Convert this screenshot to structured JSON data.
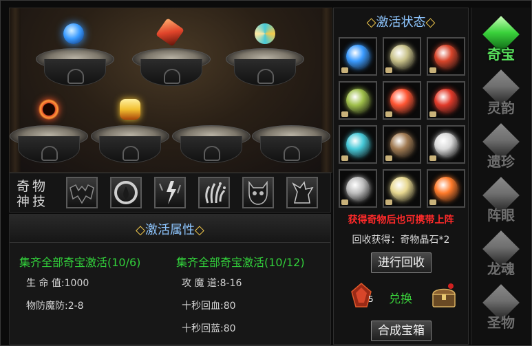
{
  "scene": {
    "altars": [
      {
        "item": "blue-orb-item",
        "color": "#3a9bff",
        "placed": true
      },
      {
        "item": "red-crossbow-item",
        "color": "#e0442a",
        "placed": true
      },
      {
        "item": "jade-swirl-item",
        "color": "#46c9d8",
        "placed": true
      },
      {
        "item": "fire-ring-item",
        "color": "#e8532a",
        "placed": true
      },
      {
        "item": "golden-lantern-item",
        "color": "#f2c030",
        "placed": true
      },
      {
        "item": "empty-altar",
        "color": "",
        "placed": false
      },
      {
        "item": "empty-altar",
        "color": "",
        "placed": false
      }
    ]
  },
  "skills": {
    "title": "奇物神技",
    "icons": [
      "demon-mask-icon",
      "flame-circle-icon",
      "lightning-strike-icon",
      "claw-hand-icon",
      "horned-skull-icon",
      "dark-beast-icon"
    ]
  },
  "attributes": {
    "title": "激活属性",
    "col1": {
      "header": "集齐全部奇宝激活(10/6)",
      "stats": [
        {
          "label": "生  命  值:",
          "value": "1000"
        },
        {
          "label": "物防魔防:",
          "value": "2-8"
        }
      ]
    },
    "col2": {
      "header": "集齐全部奇宝激活(10/12)",
      "stats": [
        {
          "label": "攻  魔  道:",
          "value": "8-16"
        },
        {
          "label": "十秒回血:",
          "value": "80"
        },
        {
          "label": "十秒回蓝:",
          "value": "80"
        }
      ]
    }
  },
  "status": {
    "title": "激活状态",
    "slots": [
      {
        "icon": "blue-orb-icon",
        "color": "#3a9bff"
      },
      {
        "icon": "scroll-icon",
        "color": "#c9c28a"
      },
      {
        "icon": "crossbow-icon",
        "color": "#d8442a"
      },
      {
        "icon": "jade-cube-icon",
        "color": "#9fbf4a"
      },
      {
        "icon": "red-pearl-icon",
        "color": "#ff5533"
      },
      {
        "icon": "fire-ring-icon",
        "color": "#e23a2a"
      },
      {
        "icon": "jade-swirl-icon",
        "color": "#46c9d8"
      },
      {
        "icon": "bead-bracelet-icon",
        "color": "#a07a52"
      },
      {
        "icon": "silver-orb-icon",
        "color": "#d8d8d8"
      },
      {
        "icon": "silver-bell-icon",
        "color": "#bdbdbd"
      },
      {
        "icon": "golden-talisman-icon",
        "color": "#e8d890"
      },
      {
        "icon": "rainbow-disc-icon",
        "color": "#ff7a2a"
      }
    ],
    "warning": "获得奇物后也可携带上阵",
    "recycle_text": "回收获得：奇物晶石*2",
    "recycle_button": "进行回收",
    "exchange_label": "兑换",
    "crystal_count": "5",
    "synthesize_button": "合成宝箱"
  },
  "tabs": [
    {
      "label": "奇宝",
      "active": true,
      "color": "#3ad23b"
    },
    {
      "label": "灵韵",
      "active": false,
      "color": "#6f6f6f"
    },
    {
      "label": "遗珍",
      "active": false,
      "color": "#6f6f6f"
    },
    {
      "label": "阵眼",
      "active": false,
      "color": "#6f6f6f"
    },
    {
      "label": "龙魂",
      "active": false,
      "color": "#6f6f6f"
    },
    {
      "label": "圣物",
      "active": false,
      "color": "#6f6f6f"
    }
  ]
}
